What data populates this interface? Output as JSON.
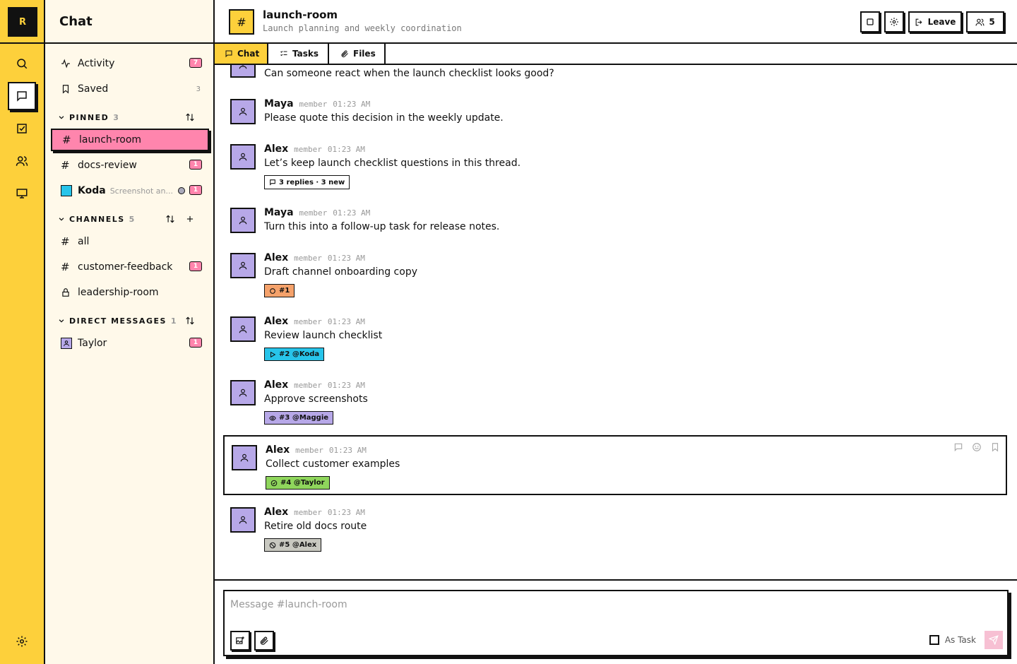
{
  "rail": {
    "logo": "R",
    "items": [
      {
        "name": "search-icon"
      },
      {
        "name": "chat-icon",
        "active": true
      },
      {
        "name": "tasks-icon"
      },
      {
        "name": "people-icon"
      },
      {
        "name": "monitor-icon"
      },
      {
        "name": "settings-icon"
      }
    ]
  },
  "sidebar": {
    "title": "Chat",
    "activity": {
      "label": "Activity",
      "badge": "7"
    },
    "saved": {
      "label": "Saved",
      "count": "3"
    },
    "pinned": {
      "label": "PINNED",
      "count": "3",
      "items": [
        {
          "label": "launch-room",
          "icon": "hash"
        },
        {
          "label": "docs-review",
          "icon": "hash",
          "badge": "1"
        },
        {
          "label": "Koda",
          "preview": "Screenshot an...",
          "icon": "avatar-cyan",
          "badge": "1"
        }
      ]
    },
    "channels": {
      "label": "CHANNELS",
      "count": "5",
      "items": [
        {
          "label": "all",
          "icon": "hash"
        },
        {
          "label": "customer-feedback",
          "icon": "hash",
          "badge": "1"
        },
        {
          "label": "leadership-room",
          "icon": "lock"
        }
      ]
    },
    "dms": {
      "label": "DIRECT MESSAGES",
      "count": "1",
      "items": [
        {
          "label": "Taylor",
          "badge": "1"
        }
      ]
    }
  },
  "header": {
    "hash": "#",
    "title": "launch-room",
    "subtitle": "Launch planning and weekly coordination",
    "leave_label": "Leave",
    "members_count": "5"
  },
  "tabs": [
    {
      "label": "Chat",
      "active": true
    },
    {
      "label": "Tasks"
    },
    {
      "label": "Files"
    }
  ],
  "messages": [
    {
      "text": "Can someone react when the launch checklist looks good?"
    },
    {
      "author": "Maya",
      "role": "member",
      "time": "01:23 AM",
      "text": "Please quote this decision in the weekly update."
    },
    {
      "author": "Alex",
      "role": "member",
      "time": "01:23 AM",
      "text": "Let’s keep launch checklist questions in this thread.",
      "thread": "3 replies · 3 new"
    },
    {
      "author": "Maya",
      "role": "member",
      "time": "01:23 AM",
      "text": "Turn this into a follow-up task for release notes."
    },
    {
      "author": "Alex",
      "role": "member",
      "time": "01:23 AM",
      "text": "Draft channel onboarding copy",
      "task": {
        "label": "#1",
        "color": "#f5a26b",
        "icon": "circle"
      }
    },
    {
      "author": "Alex",
      "role": "member",
      "time": "01:23 AM",
      "text": "Review launch checklist",
      "task": {
        "label": "#2 @Koda",
        "color": "#27c4ea",
        "icon": "play"
      }
    },
    {
      "author": "Alex",
      "role": "member",
      "time": "01:23 AM",
      "text": "Approve screenshots",
      "task": {
        "label": "#3 @Maggie",
        "color": "#b7a8e8",
        "icon": "eye"
      }
    },
    {
      "author": "Alex",
      "role": "member",
      "time": "01:23 AM",
      "text": "Collect customer examples",
      "task": {
        "label": "#4 @Taylor",
        "color": "#8fd65c",
        "icon": "check-circle"
      },
      "highlighted": true
    },
    {
      "author": "Alex",
      "role": "member",
      "time": "01:23 AM",
      "text": "Retire old docs route",
      "task": {
        "label": "#5 @Alex",
        "color": "#c8c8c0",
        "icon": "ban"
      }
    }
  ],
  "composer": {
    "placeholder": "Message #launch-room",
    "as_task_label": "As Task"
  },
  "colors": {
    "accent_yellow": "#fdd03b",
    "pink": "#ff85ad",
    "avatar_purple": "#b7a8e8",
    "sidebar_bg": "#fff9ea"
  }
}
